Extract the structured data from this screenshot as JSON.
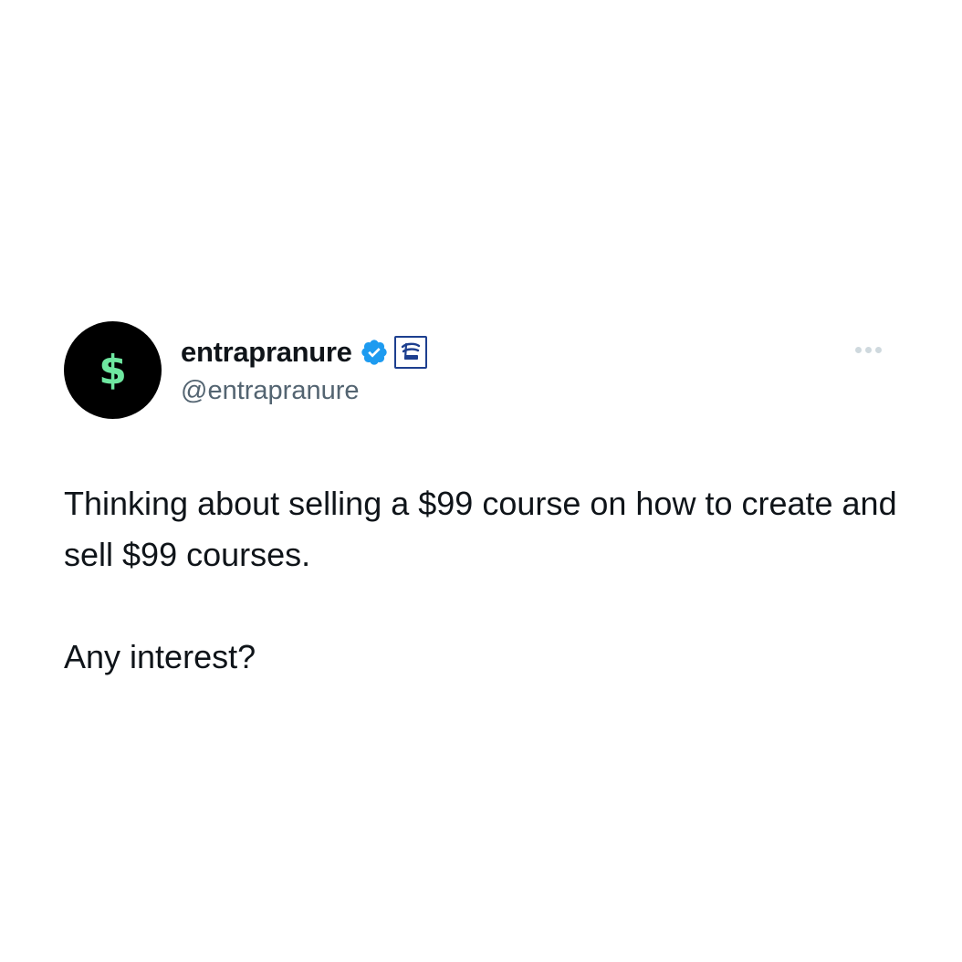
{
  "tweet": {
    "author": {
      "display_name": "entrapranure",
      "handle": "@entrapranure",
      "avatar_glyph": "$",
      "avatar_bg": "#000000",
      "avatar_glyph_color": "#6ee7a0",
      "verified_icon": "verified-badge-icon",
      "verified_color": "#1d9bf0",
      "affiliate_icon": "friday-beers-affiliate-badge"
    },
    "more_icon": "more-options-icon",
    "paragraphs": [
      "Thinking about selling a $99 course on how to create and sell $99 courses.",
      "Any interest?"
    ]
  }
}
